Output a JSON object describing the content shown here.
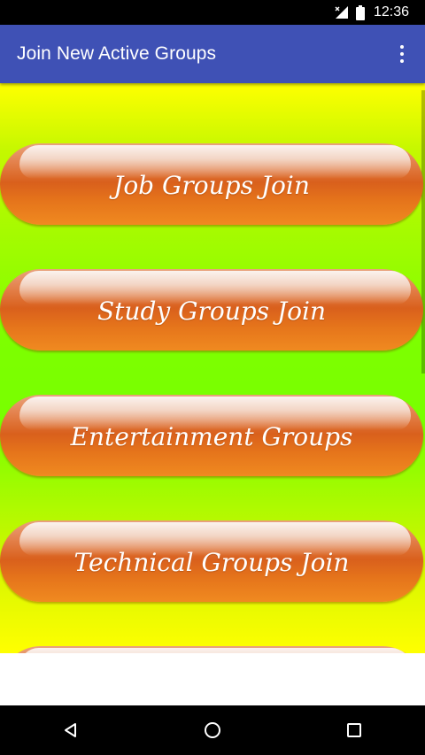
{
  "status_bar": {
    "time": "12:36",
    "icons": [
      "signal-icon",
      "battery-icon"
    ]
  },
  "app_bar": {
    "title": "Join New Active Groups",
    "menu_icon": "overflow-menu-icon"
  },
  "buttons": [
    {
      "label": "Job Groups Join"
    },
    {
      "label": "Study Groups Join"
    },
    {
      "label": "Entertainment Groups"
    },
    {
      "label": "Technical Groups Join"
    },
    {
      "label": ""
    }
  ],
  "nav_bar": {
    "icons": [
      "back-icon",
      "home-icon",
      "recents-icon"
    ]
  },
  "colors": {
    "app_bar": "#3f51b5",
    "button_orange": "#e5741b",
    "background_top": "#ffff00",
    "background_mid": "#78ff00"
  }
}
